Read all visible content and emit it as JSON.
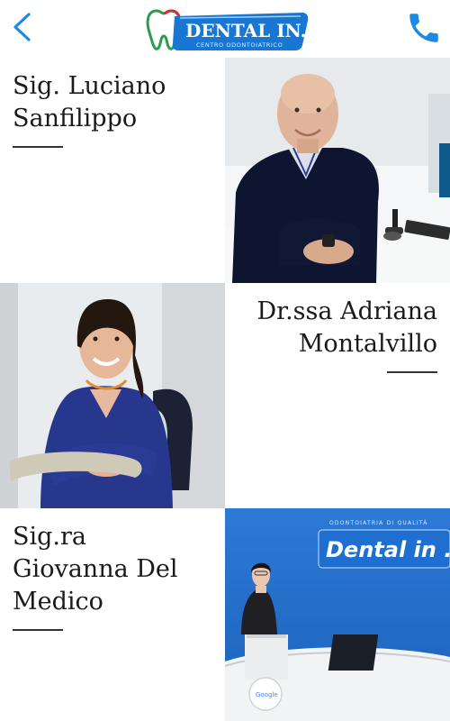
{
  "header": {
    "back_icon": "chevron-left-icon",
    "call_icon": "phone-icon",
    "logo": {
      "brand": "DENTAL IN...",
      "tagline": "CENTRO ODONTOIATRICO"
    },
    "accent_color": "#1e88e5"
  },
  "staff": [
    {
      "name_line1": "Sig. Luciano",
      "name_line2": "Sanfilippo",
      "name_line3": "",
      "text_align": "left"
    },
    {
      "name_line1": "Dr.ssa Adriana",
      "name_line2": "Montalvillo",
      "name_line3": "",
      "text_align": "right"
    },
    {
      "name_line1": "Sig.ra",
      "name_line2": "Giovanna Del",
      "name_line3": "Medico",
      "text_align": "left"
    }
  ],
  "photo3": {
    "sign_text": "Dental in ...",
    "banner_text": "ODONTOIATRIA DI QUALITÀ",
    "badge_text": "Google"
  }
}
